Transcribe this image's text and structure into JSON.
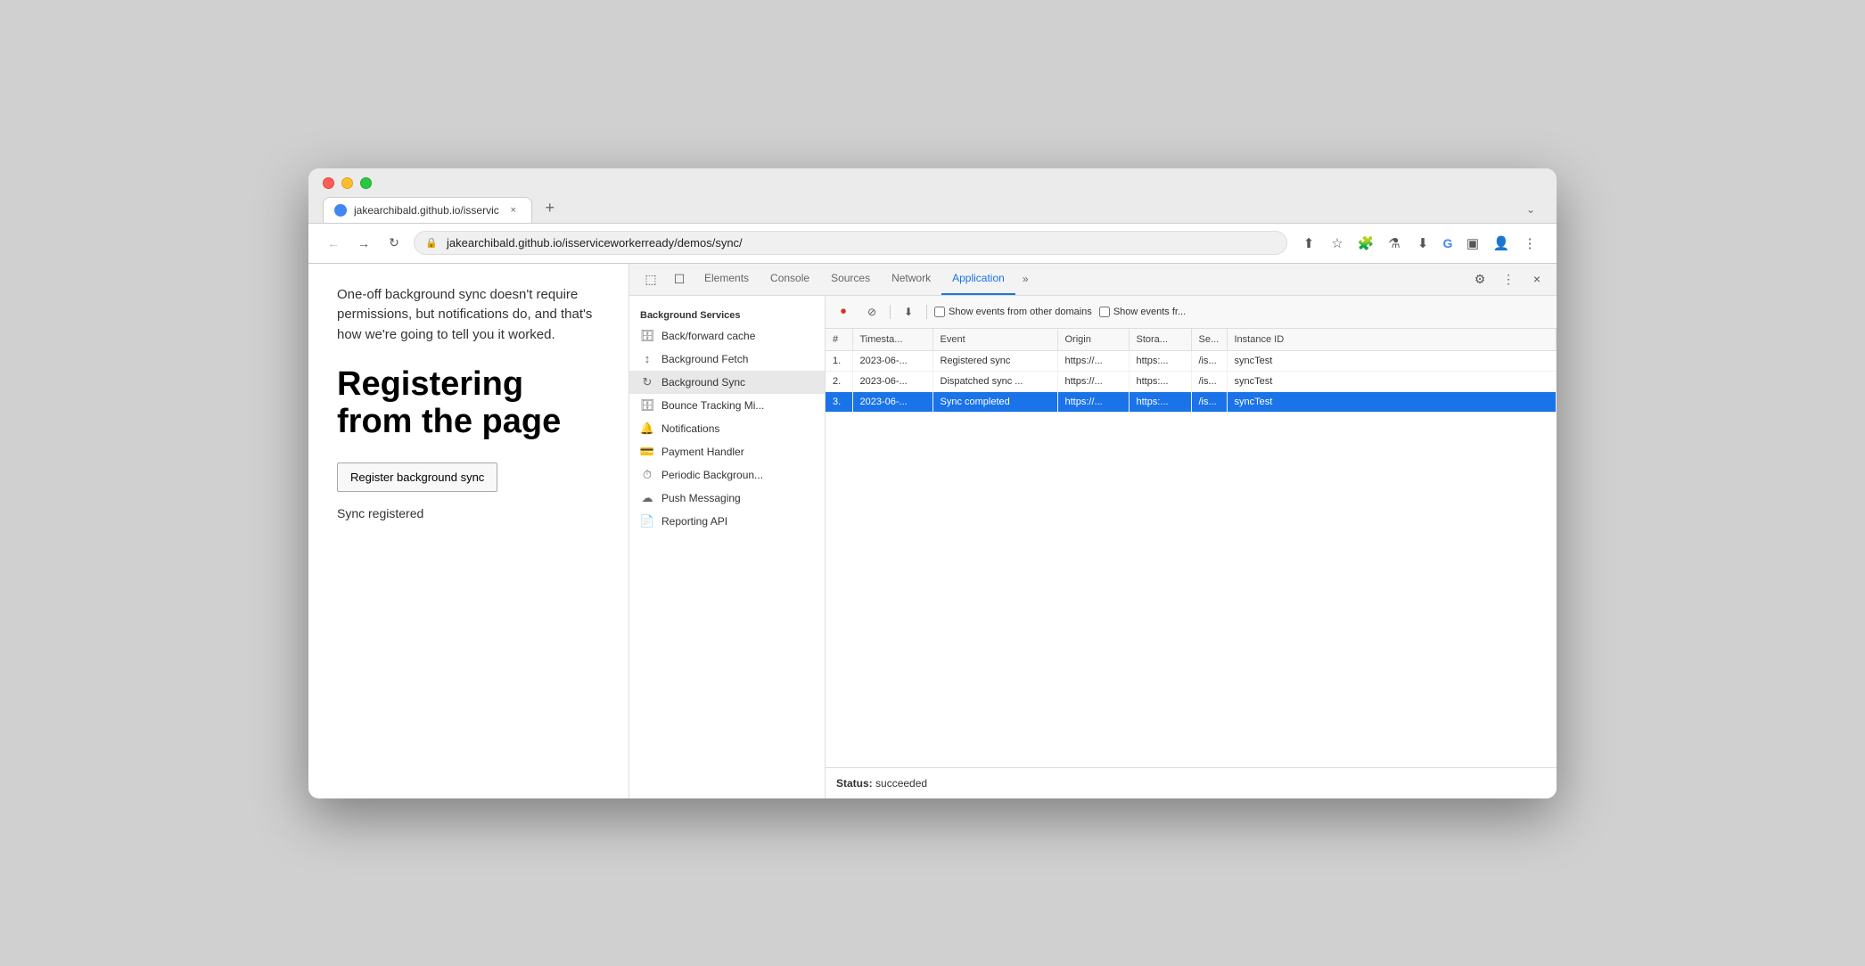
{
  "browser": {
    "tab": {
      "favicon_color": "#4285f4",
      "title": "jakearchibald.github.io/isservic",
      "close_label": "×"
    },
    "new_tab_label": "+",
    "overflow_label": "⌄",
    "nav": {
      "back_label": "←",
      "forward_label": "→",
      "refresh_label": "↻",
      "secure_icon": "🔒",
      "url_full": "jakearchibald.github.io/isserviceworkerready/demos/sync/",
      "url_domain": "jakearchibald.github.io",
      "url_path": "/isserviceworkerready/demos/sync/"
    },
    "toolbar": {
      "share": "⬆",
      "bookmark": "☆",
      "extension": "🧩",
      "lab": "⚗",
      "download": "⬇",
      "google": "G",
      "sidebar": "▣",
      "profile": "👤",
      "menu": "⋮"
    }
  },
  "webpage": {
    "description": "One-off background sync doesn't require permissions, but notifications do, and that's how we're going to tell you it worked.",
    "heading": "Registering from the page",
    "button_label": "Register background sync",
    "status": "Sync registered"
  },
  "devtools": {
    "panel_icons": [
      "⬚",
      "☐"
    ],
    "tabs": [
      "Elements",
      "Console",
      "Sources",
      "Network",
      "Application"
    ],
    "active_tab": "Application",
    "overflow_label": "»",
    "action_gear": "⚙",
    "action_menu": "⋮",
    "action_close": "×",
    "toolbar": {
      "record_label": "⏺",
      "clear_label": "⊘",
      "download_label": "⬇",
      "checkbox1_label": "Show events from other domains",
      "checkbox2_label": "Show events fr..."
    },
    "sidebar": {
      "section_title": "Background Services",
      "items": [
        {
          "icon": "🗄",
          "label": "Back/forward cache"
        },
        {
          "icon": "↕",
          "label": "Background Fetch"
        },
        {
          "icon": "↻",
          "label": "Background Sync",
          "active": true
        },
        {
          "icon": "🗄",
          "label": "Bounce Tracking Mi..."
        },
        {
          "icon": "🔔",
          "label": "Notifications"
        },
        {
          "icon": "💳",
          "label": "Payment Handler"
        },
        {
          "icon": "⏱",
          "label": "Periodic Backgroun..."
        },
        {
          "icon": "☁",
          "label": "Push Messaging"
        },
        {
          "icon": "📄",
          "label": "Reporting API"
        }
      ]
    },
    "table": {
      "columns": [
        "#",
        "Timesta...",
        "Event",
        "Origin",
        "Stora...",
        "Se...",
        "Instance ID"
      ],
      "rows": [
        {
          "num": "1.",
          "timestamp": "2023-06-...",
          "event": "Registered sync",
          "origin": "https://...",
          "storage": "https:...",
          "se": "/is...",
          "instance_id": "syncTest",
          "selected": false
        },
        {
          "num": "2.",
          "timestamp": "2023-06-...",
          "event": "Dispatched sync ...",
          "origin": "https://...",
          "storage": "https:...",
          "se": "/is...",
          "instance_id": "syncTest",
          "selected": false
        },
        {
          "num": "3.",
          "timestamp": "2023-06-...",
          "event": "Sync completed",
          "origin": "https://...",
          "storage": "https:...",
          "se": "/is...",
          "instance_id": "syncTest",
          "selected": true
        }
      ]
    },
    "status": {
      "label": "Status:",
      "value": "succeeded"
    }
  }
}
